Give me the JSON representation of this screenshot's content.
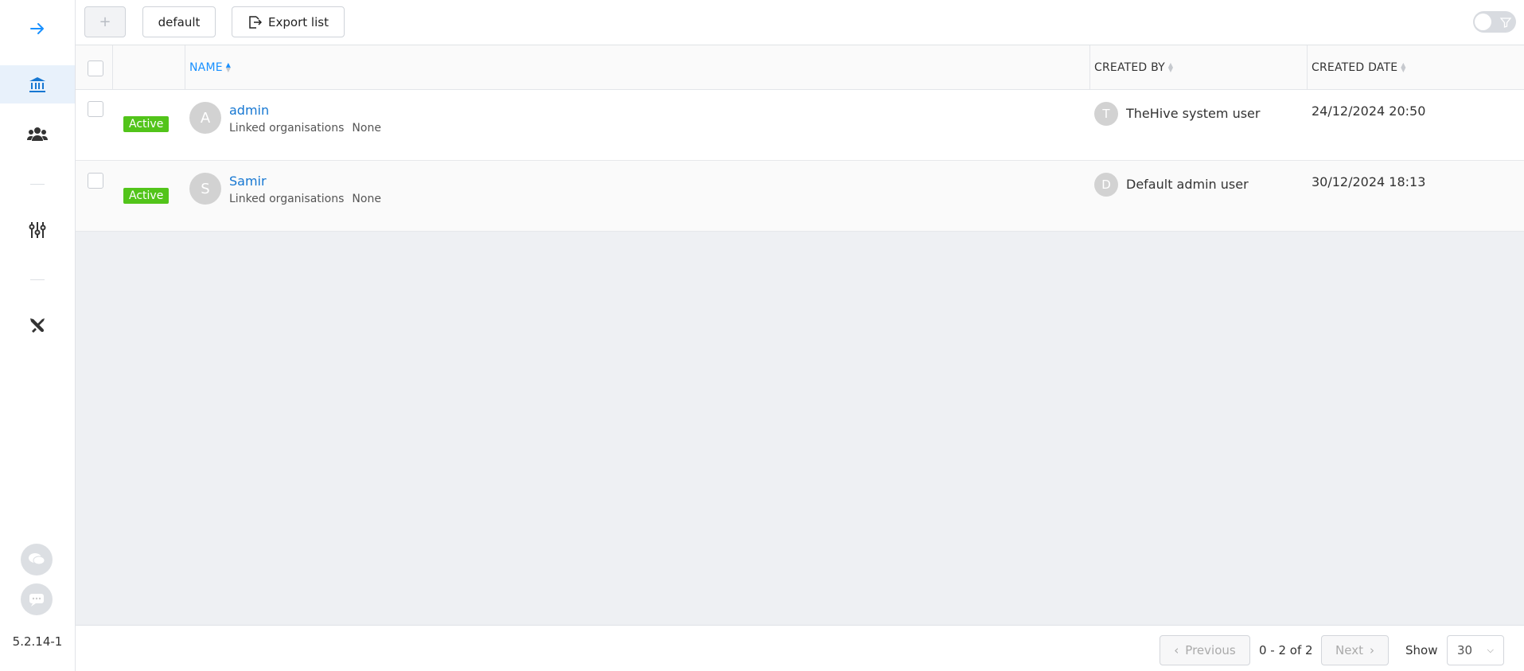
{
  "sidebar": {
    "items": [
      {
        "name": "arrow-right-icon"
      },
      {
        "name": "bank-icon",
        "active": true
      },
      {
        "name": "users-icon"
      },
      {
        "name": "sliders-icon"
      },
      {
        "name": "tools-icon"
      }
    ],
    "bottom": [
      {
        "name": "chat-bubbles-icon"
      },
      {
        "name": "chat-icon"
      }
    ],
    "version": "5.2.14-1"
  },
  "toolbar": {
    "add_label": "+",
    "default_label": "default",
    "export_label": "Export list"
  },
  "table": {
    "columns": {
      "name": "NAME",
      "created_by": "CREATED BY",
      "created_date": "CREATED DATE"
    },
    "rows": [
      {
        "status": "Active",
        "avatar": "A",
        "name": "admin",
        "linked_label": "Linked organisations",
        "linked_value": "None",
        "creator_avatar": "T",
        "created_by": "TheHive system user",
        "created_date": "24/12/2024 20:50"
      },
      {
        "status": "Active",
        "avatar": "S",
        "name": "Samir",
        "linked_label": "Linked organisations",
        "linked_value": "None",
        "creator_avatar": "D",
        "created_by": "Default admin user",
        "created_date": "30/12/2024 18:13"
      }
    ]
  },
  "pagination": {
    "previous_label": "Previous",
    "range": "0 - 2 of 2",
    "next_label": "Next",
    "show_label": "Show",
    "page_size": "30"
  },
  "colors": {
    "accent": "#1890ff",
    "active_badge": "#52c41a"
  }
}
